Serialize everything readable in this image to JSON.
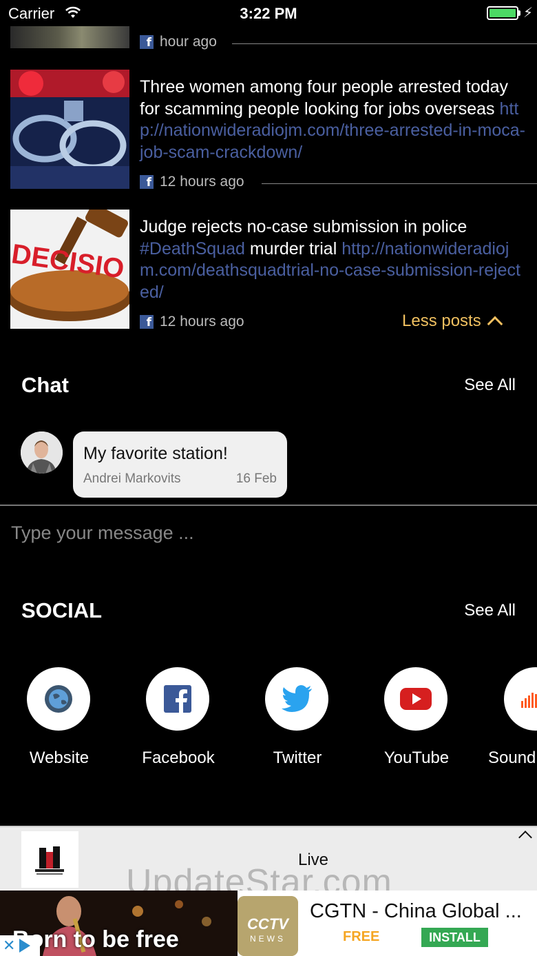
{
  "status_bar": {
    "carrier": "Carrier",
    "time": "3:22 PM"
  },
  "posts": [
    {
      "time_ago": "hour ago"
    },
    {
      "text": "Three women among four people arrested today for scamming people looking for jobs overseas ",
      "link": "http://nationwideradiojm.com/three-arrested-in-moca-job-scam-crackdown/",
      "time_ago": "12 hours ago"
    },
    {
      "text_before": "Judge rejects no-case submission in police ",
      "hashtag": "#DeathSquad",
      "text_after": " murder trial ",
      "link": "http://nationwideradiojm.com/deathsquadtrial-no-case-submission-rejected/",
      "time_ago": "12 hours ago",
      "thumb_word": "DECISIO"
    }
  ],
  "less_posts_label": "Less posts",
  "chat": {
    "title": "Chat",
    "see_all": "See All",
    "message": "My favorite station!",
    "author": "Andrei Markovits",
    "date": "16 Feb",
    "input_placeholder": "Type your message ..."
  },
  "social": {
    "title": "SOCIAL",
    "see_all": "See All",
    "items": [
      {
        "label": "Website",
        "icon": "globe-icon"
      },
      {
        "label": "Facebook",
        "icon": "facebook-icon"
      },
      {
        "label": "Twitter",
        "icon": "twitter-icon"
      },
      {
        "label": "YouTube",
        "icon": "youtube-icon"
      },
      {
        "label": "Sound",
        "icon": "soundcloud-icon"
      }
    ]
  },
  "player": {
    "status": "Live"
  },
  "watermark": "UpdateStar.com",
  "ad": {
    "headline": "Born to be free",
    "app_name": "CGTN - China Global ...",
    "price": "FREE",
    "install_label": "INSTALL",
    "icon_text_top": "CCTV",
    "icon_text_bottom": "NEWS"
  },
  "colors": {
    "background": "#000000",
    "link": "#4a5fa0",
    "accent_orange": "#f0c060",
    "facebook": "#3b5998",
    "battery_green": "#4cd964",
    "install_green": "#34a853"
  }
}
